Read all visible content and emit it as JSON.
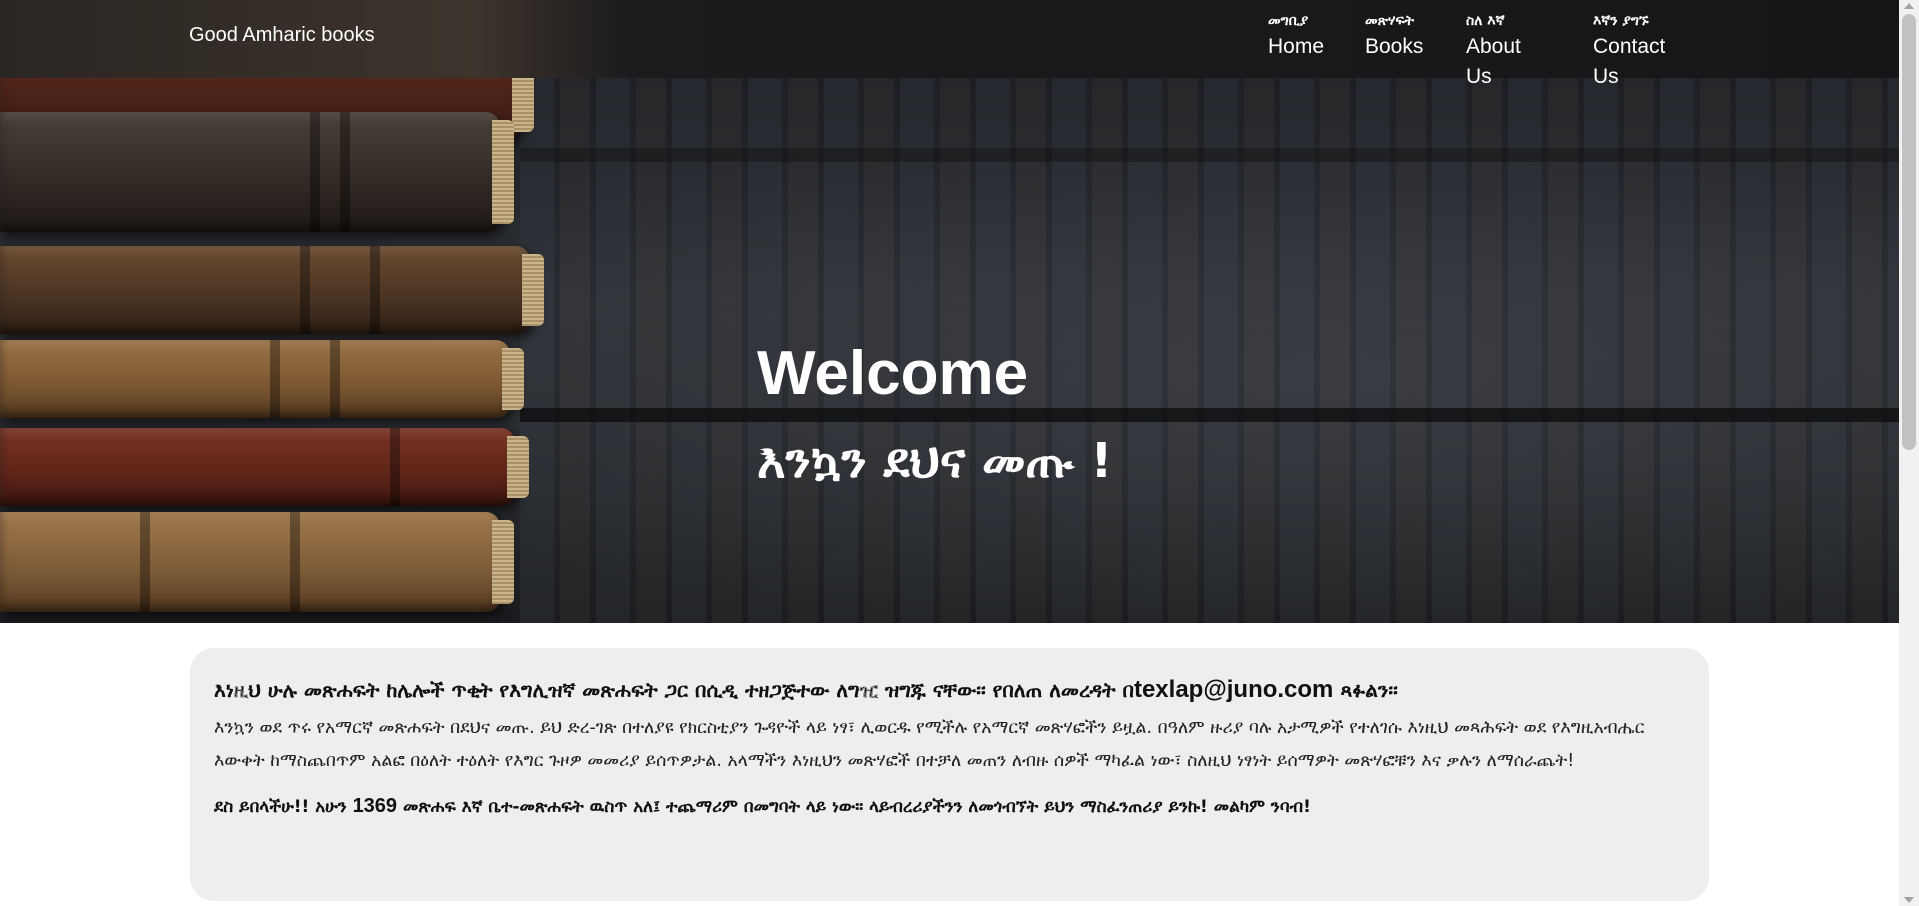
{
  "header": {
    "brand": "Good Amharic books",
    "nav": [
      {
        "amharic": "መግቢያ",
        "english": "Home"
      },
      {
        "amharic": "መጽሃፍት",
        "english": "Books"
      },
      {
        "amharic": "ስለ እኛ",
        "english": "About Us"
      },
      {
        "amharic": "እኛን ያግኙ",
        "english": "Contact Us"
      }
    ]
  },
  "hero": {
    "title": "Welcome",
    "subtitle": "እንኳን ደህና መጡ !"
  },
  "intro": {
    "lead_prefix": "እነዚህ ሁሉ መጽሐፍት ከሌሎች ጥቂት የእግሊዝኛ መጽሐፍት ጋር በሲዲ ተዘጋጅተው ለግዢ ዝግጁ ናቸው፡፡ የበለጠ ለመረዳት በ",
    "lead_email": "texlap@juno.com",
    "lead_suffix": " ጻፉልን፡፡",
    "body": "እንኳን ወደ ጥሩ የአማርኛ መጽሐፍት በደህና መጡ. ይህ ድረ-ገጽ በተለያዩ የክርስቲያን ጉዳዮች ላይ ነፃ፣ ሊወርዱ የሚችሉ የአማርኛ መጽሃፎችን ይዟል. በዓለም ዙሪያ ባሉ አታሚዎች የተለገሱ እነዚህ መጻሕፍት ወደ የእግዚአብሔር እውቀት ከማስጨበጥም አልፎ በዕለት ተዕለት የእግር ጉዞዎ መመሪያ ይሰጥዎታል. አላማችን እነዚህን መጽሃፎች በተቻለ መጠን ለብዙ ሰዎች ማካፈል ነው፣ ስለዚህ ነፃነት ይሰማዎት መጽሃፎቹን እና ቃሉን ለማሰራጨት!",
    "foot_prefix": "ደስ ይበላችሁ!! አሁን ",
    "foot_count": "1369",
    "foot_suffix": " መጽሐፍ እኛ ቤተ-መጽሐፍት ዉስጥ አለ፤ ተጨማሪም በመግባት ላይ ነው። ላይብረሪያችንን ለመጎብኘት ይህን ማስፈንጠሪያ ይንኩ! መልካም ንባብ!"
  }
}
